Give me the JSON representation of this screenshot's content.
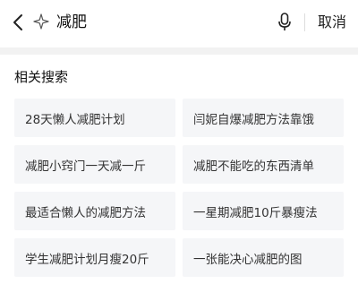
{
  "search": {
    "query": "减肥",
    "cancel_label": "取消",
    "back_icon": "chevron-left-icon",
    "star_icon": "sparkle-icon",
    "mic_icon": "microphone-icon"
  },
  "related": {
    "title": "相关搜索",
    "items": [
      {
        "label": "28天懒人减肥计划"
      },
      {
        "label": "闫妮自爆减肥方法靠饿"
      },
      {
        "label": "减肥小窍门一天减一斤"
      },
      {
        "label": "减肥不能吃的东西清单"
      },
      {
        "label": "最适合懒人的减肥方法"
      },
      {
        "label": "一星期减肥10斤暴瘦法"
      },
      {
        "label": "学生减肥计划月瘦20斤"
      },
      {
        "label": "一张能决心减肥的图"
      }
    ]
  }
}
